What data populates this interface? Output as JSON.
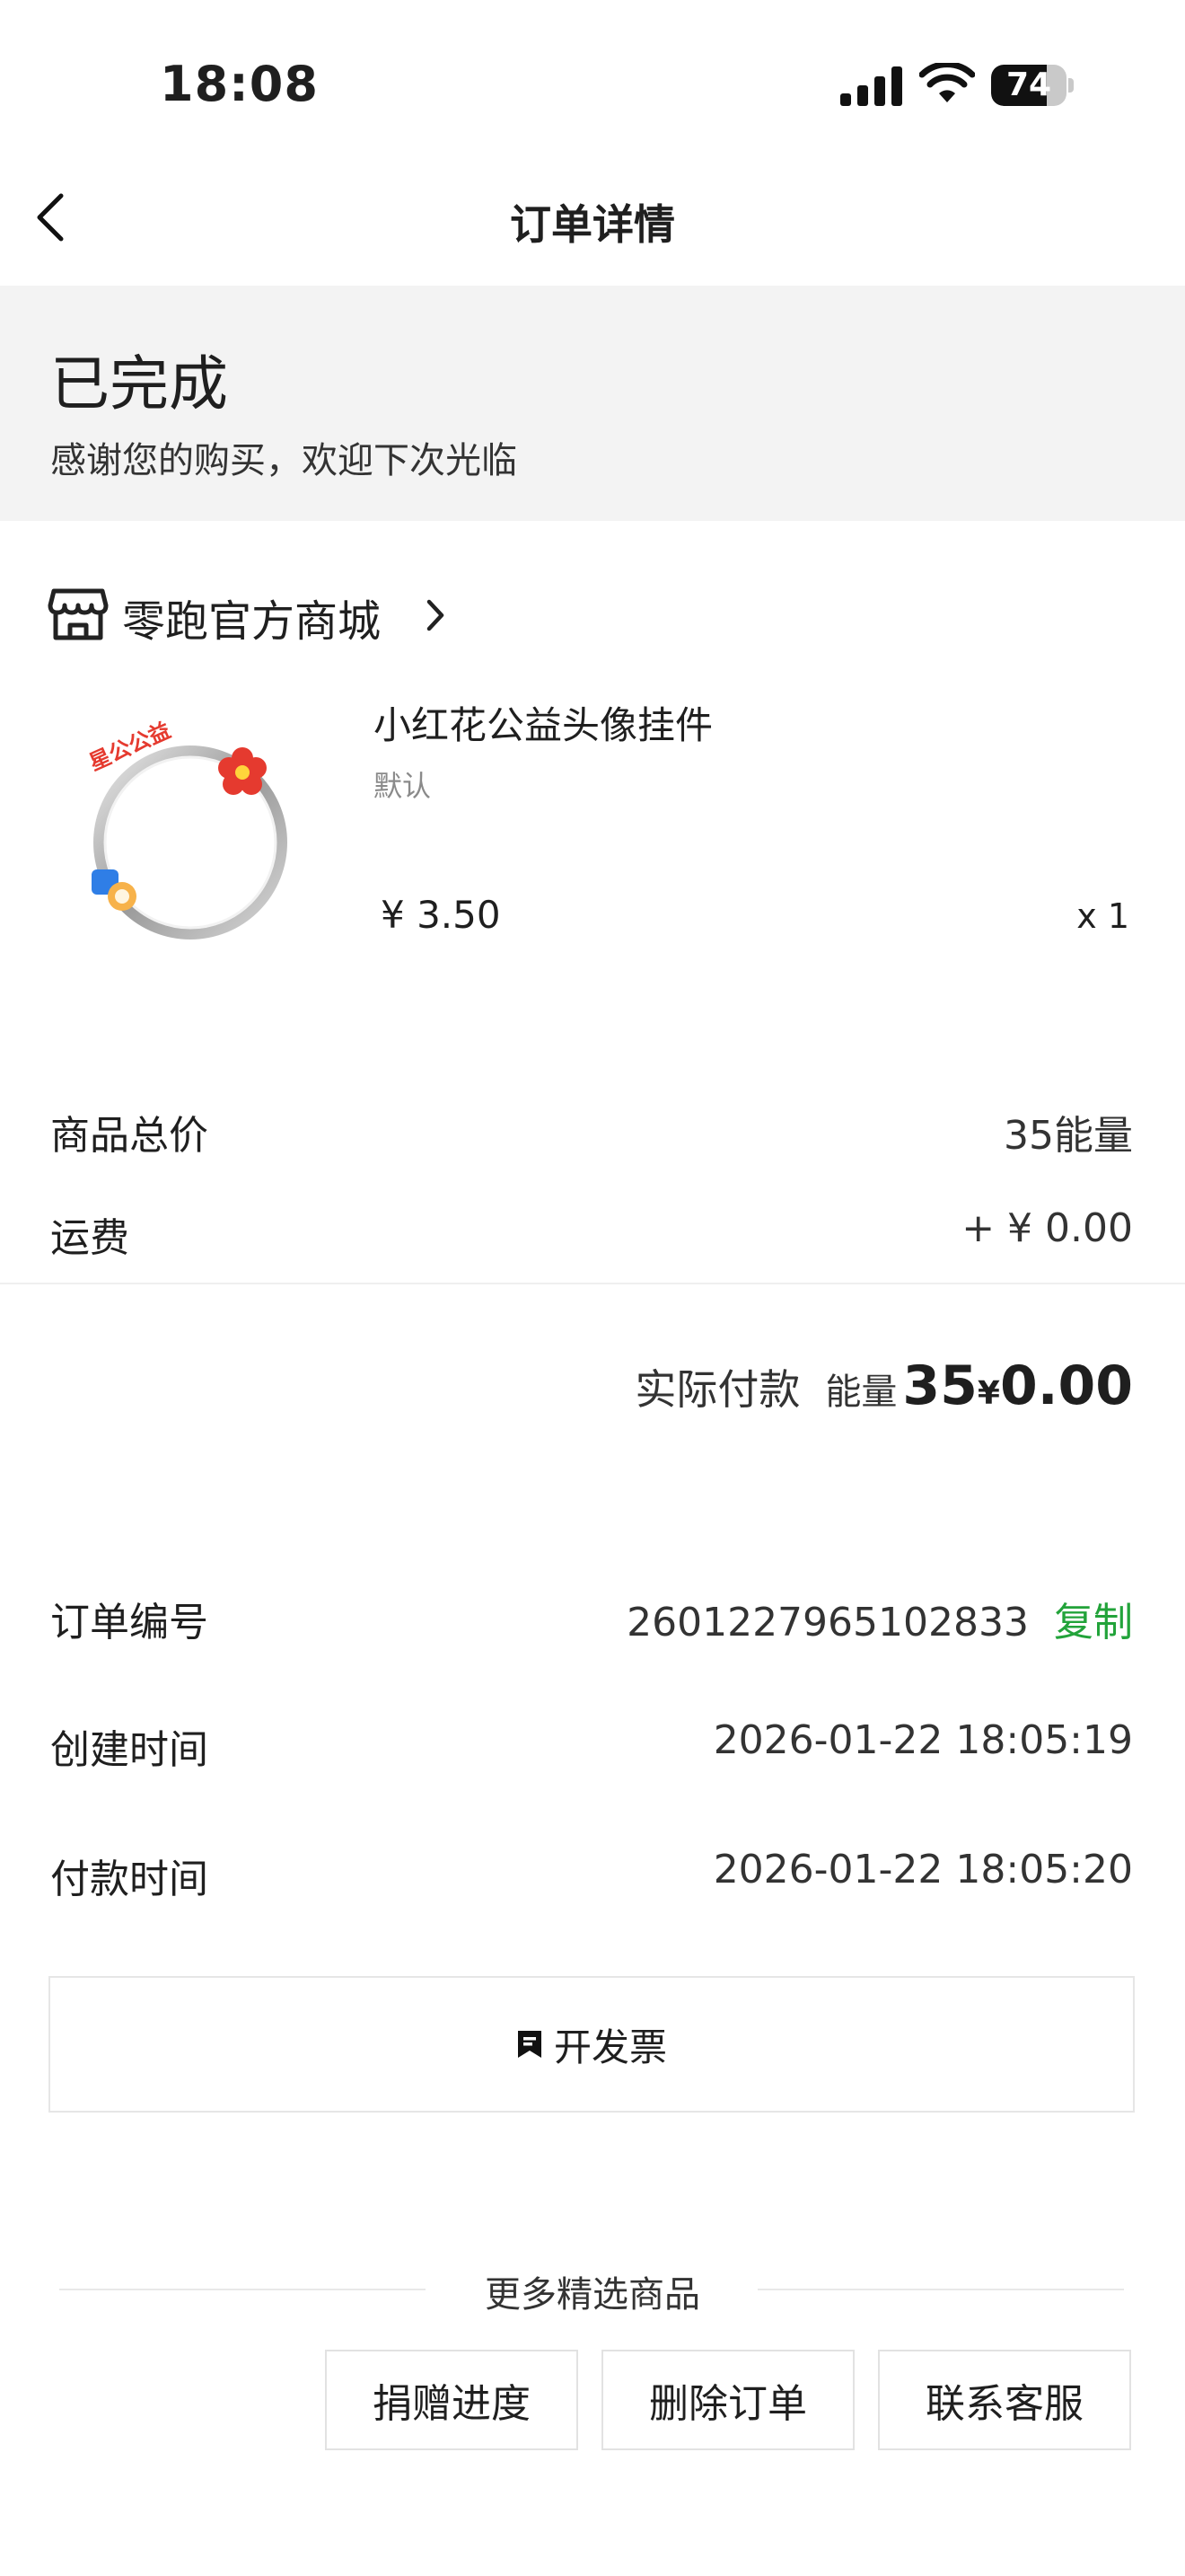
{
  "status_bar": {
    "time": "18:08",
    "battery_percent": "74",
    "battery_level": 0.74
  },
  "nav": {
    "title": "订单详情"
  },
  "order_status": {
    "title": "已完成",
    "subtitle": "感谢您的购买，欢迎下次光临"
  },
  "store": {
    "name": "零跑官方商城"
  },
  "product": {
    "name": "小红花公益头像挂件",
    "variant": "默认",
    "price": "¥ 3.50",
    "quantity": "x 1",
    "thumb_text": "星公公益"
  },
  "summary": {
    "total_label": "商品总价",
    "total_value": "35能量",
    "shipping_label": "运费",
    "shipping_value": "+ ¥ 0.00"
  },
  "payment": {
    "label": "实际付款",
    "energy_label": "能量",
    "energy_value": "35",
    "currency": "¥",
    "amount": "0.00"
  },
  "order_info": {
    "number_label": "订单编号",
    "number_value": "2601227965102833",
    "copy_label": "复制",
    "created_label": "创建时间",
    "created_value": "2026-01-22 18:05:19",
    "paid_label": "付款时间",
    "paid_value": "2026-01-22 18:05:20"
  },
  "invoice": {
    "label": "开发票"
  },
  "more": {
    "title": "更多精选商品"
  },
  "actions": {
    "donation": "捐赠进度",
    "delete": "删除订单",
    "service": "联系客服"
  },
  "colors": {
    "accent_green": "#22a33a",
    "status_bg": "#f3f3f3"
  }
}
